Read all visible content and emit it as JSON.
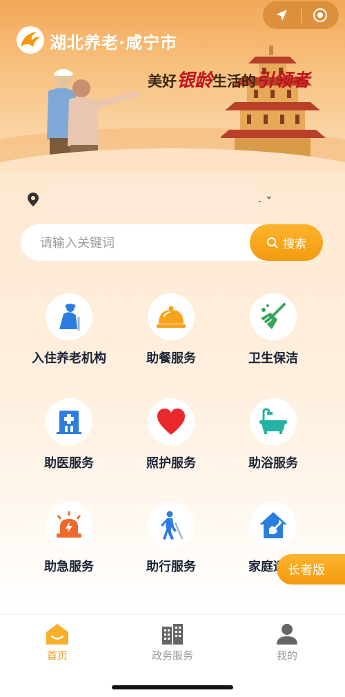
{
  "header": {
    "brand_title": "湖北养老·咸宁市",
    "slogan_prefix": "美好",
    "slogan_red1": "银龄",
    "slogan_mid": "生活的",
    "slogan_red2": "引领者"
  },
  "location": {
    "value": "",
    "suffix": "."
  },
  "search": {
    "placeholder": "请输入关键词",
    "button_label": "搜索"
  },
  "services": [
    {
      "label": "入住养老机构",
      "icon": "elderly-person-icon"
    },
    {
      "label": "助餐服务",
      "icon": "food-cloche-icon"
    },
    {
      "label": "卫生保洁",
      "icon": "broom-icon"
    },
    {
      "label": "助医服务",
      "icon": "hospital-icon"
    },
    {
      "label": "照护服务",
      "icon": "heart-icon"
    },
    {
      "label": "助浴服务",
      "icon": "bathtub-icon"
    },
    {
      "label": "助急服务",
      "icon": "alarm-light-icon"
    },
    {
      "label": "助行服务",
      "icon": "walking-cane-icon"
    },
    {
      "label": "家庭适老",
      "icon": "home-repair-icon"
    }
  ],
  "elder_mode_label": "长者版",
  "tabbar": {
    "tabs": [
      {
        "label": "首页",
        "icon": "home-icon",
        "active": true
      },
      {
        "label": "政务服务",
        "icon": "building-icon",
        "active": false
      },
      {
        "label": "我的",
        "icon": "user-icon",
        "active": false
      }
    ]
  },
  "colors": {
    "accent": "#f39a10",
    "banner": "#f3a858",
    "text_dark": "#1a2436",
    "slogan_red": "#c2121c"
  }
}
